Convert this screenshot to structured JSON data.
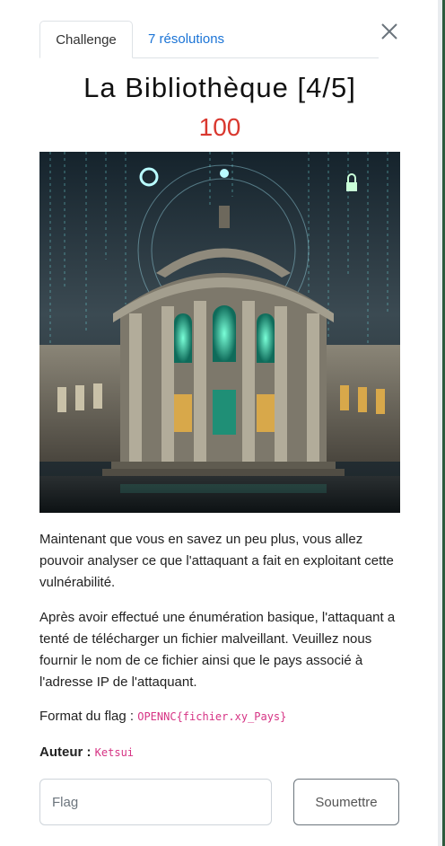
{
  "tabs": [
    {
      "label": "Challenge",
      "active": true
    },
    {
      "label": "7 résolutions",
      "active": false
    }
  ],
  "close_icon": "close-icon",
  "challenge": {
    "title": "La Bibliothèque [4/5]",
    "value": "100",
    "image_description_icon": "library-illustration"
  },
  "description": {
    "paragraph1": "Maintenant que vous en savez un peu plus, vous allez pouvoir analyser ce que l'attaquant a fait en exploitant cette vulnérabilité.",
    "paragraph2": "Après avoir effectué une énumération basique, l'attaquant a tenté de télécharger un fichier malveillant. Veuillez nous fournir le nom de ce fichier ainsi que le pays associé à l'adresse IP de l'attaquant.",
    "flag_format_label": "Format du flag :",
    "flag_format_code": "OPENNC{fichier.xy_Pays}",
    "author_label": "Auteur :",
    "author_name": "Ketsui"
  },
  "form": {
    "flag_placeholder": "Flag",
    "submit_label": "Soumettre"
  },
  "colors": {
    "accent_link": "#1b74d6",
    "value_red": "#d9382f",
    "code_pink": "#d63384"
  }
}
